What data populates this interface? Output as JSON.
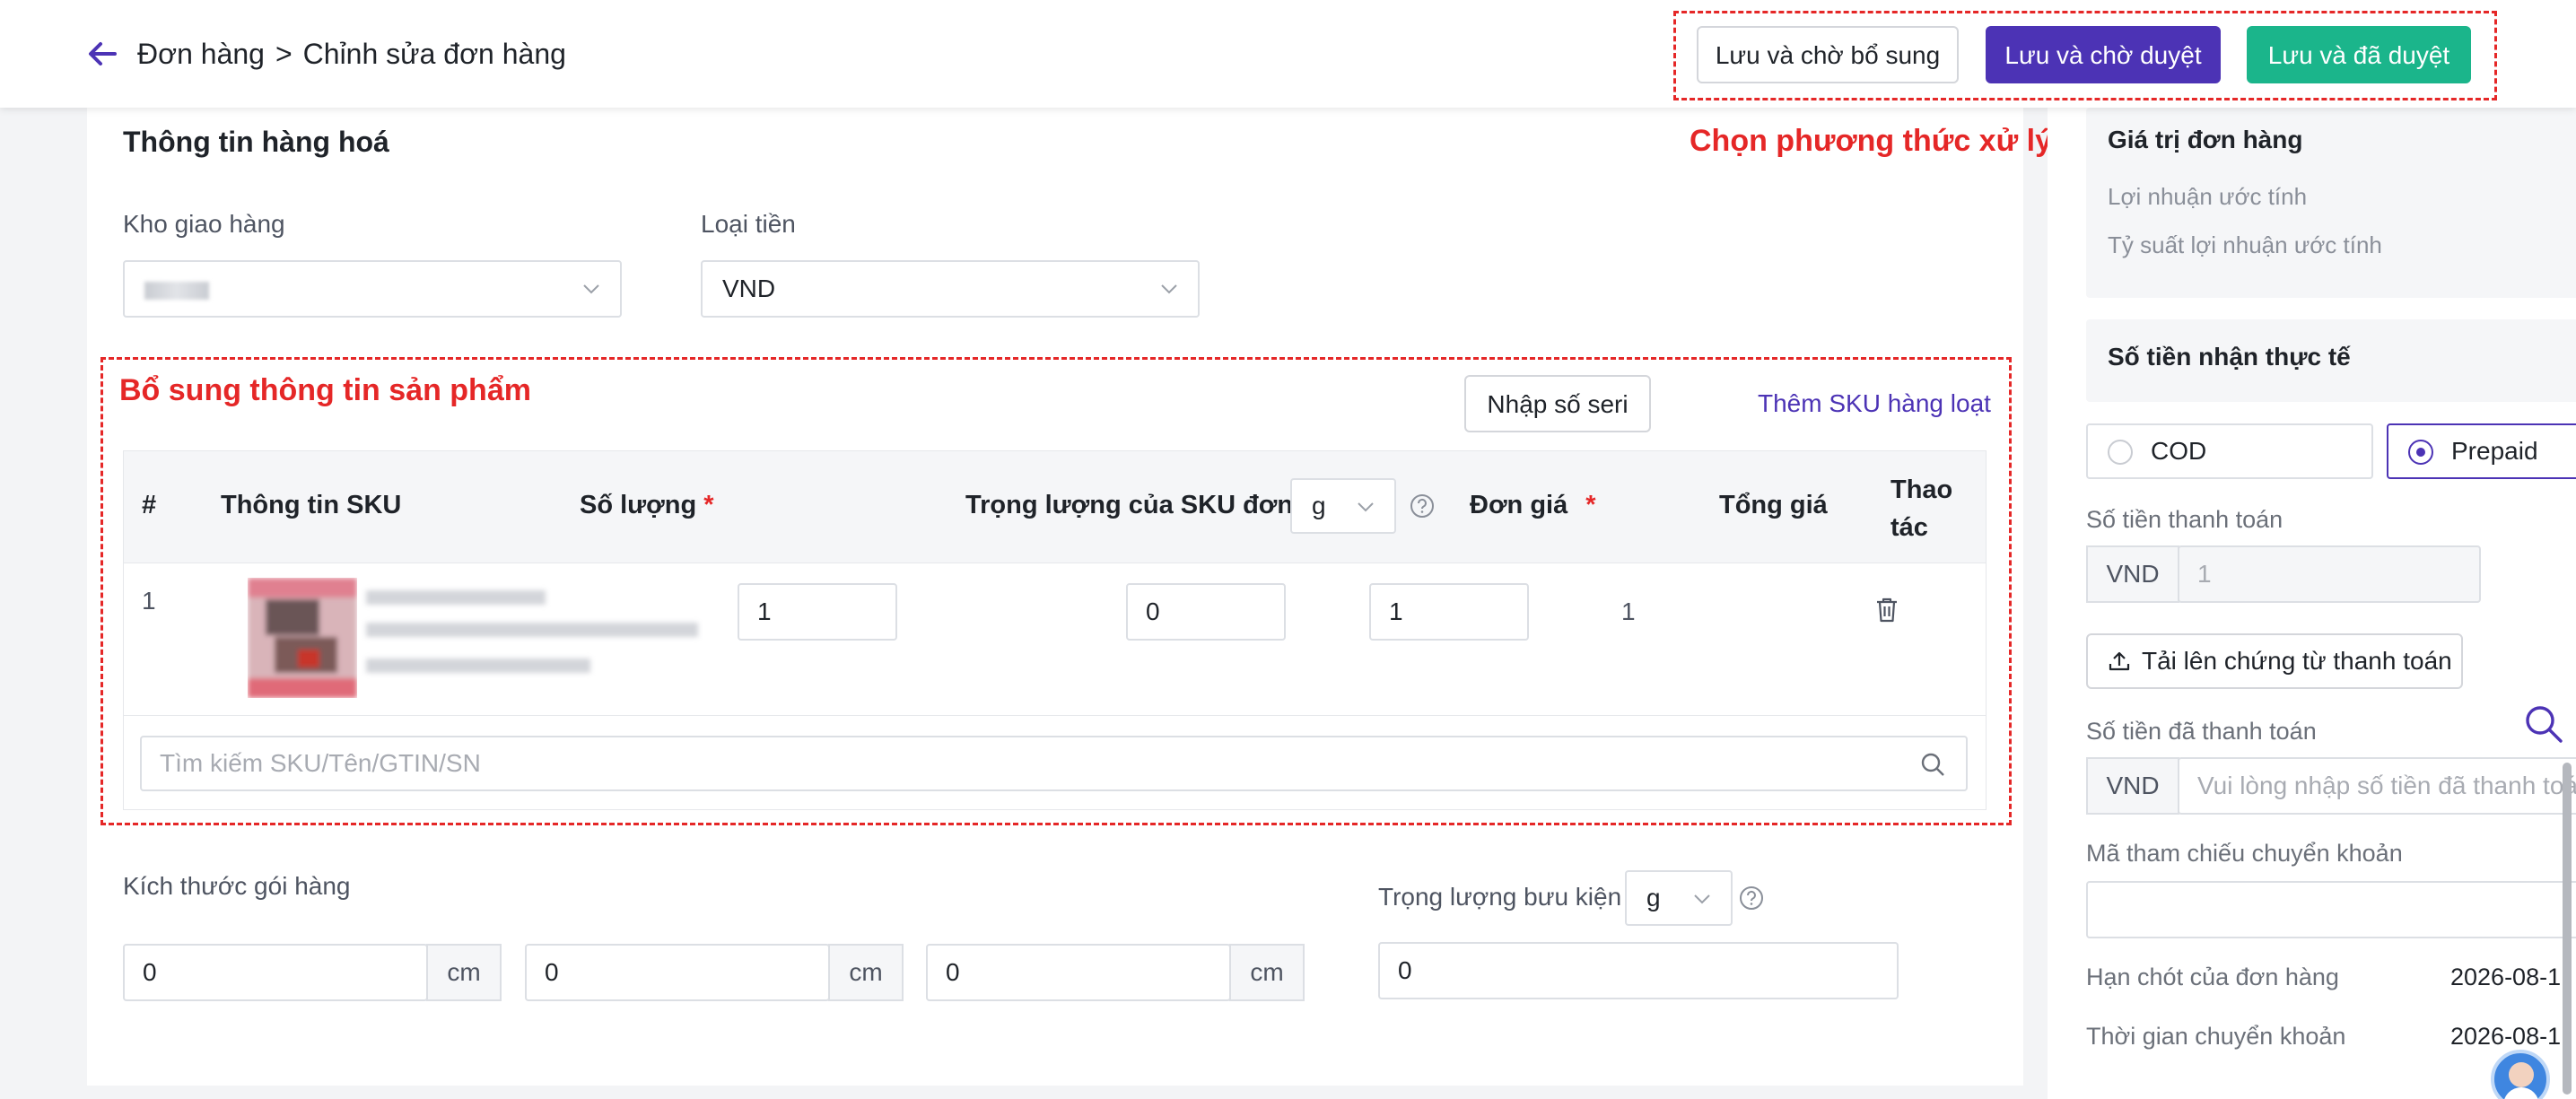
{
  "header": {
    "breadcrumb_parent": "Đơn hàng",
    "breadcrumb_separator": ">",
    "breadcrumb_current": "Chỉnh sửa đơn hàng",
    "btn_save_wait_supplement": "Lưu và chờ bổ sung",
    "btn_save_wait_approve": "Lưu và chờ duyệt",
    "btn_save_approved": "Lưu và đã duyệt",
    "annotation_process": "Chọn phương thức xử lý"
  },
  "goods": {
    "title": "Thông tin hàng hoá",
    "warehouse_label": "Kho giao hàng",
    "currency_label": "Loại tiền",
    "currency_value": "VND",
    "annotation_product": "Bổ sung thông tin sản phẩm",
    "btn_serial": "Nhập số seri",
    "btn_bulk_sku": "Thêm SKU hàng loạt",
    "table": {
      "headers": {
        "index": "#",
        "sku_info": "Thông tin SKU",
        "quantity": "Số lượng",
        "weight": "Trọng lượng của SKU đơn lẻ",
        "weight_unit": "g",
        "unit_price": "Đơn giá",
        "total": "Tổng giá",
        "action": "Thao tác"
      },
      "required_mark": "*",
      "rows": [
        {
          "index": "1",
          "quantity": "1",
          "weight": "0",
          "unit_price": "1",
          "total": "1"
        }
      ]
    },
    "search_placeholder": "Tìm kiếm SKU/Tên/GTIN/SN"
  },
  "package": {
    "size_label": "Kích thước gói hàng",
    "length": "0",
    "width": "0",
    "height": "0",
    "unit": "cm",
    "weight_label": "Trọng lượng bưu kiện",
    "weight_unit": "g",
    "weight_value": "0"
  },
  "side": {
    "order_value_title": "Giá trị đơn hàng",
    "est_profit": "Lợi nhuận ước tính",
    "est_margin": "Tỷ suất lợi nhuận ước tính",
    "actual_received_title": "Số tiền nhận thực tế",
    "cod_label": "COD",
    "prepaid_label": "Prepaid",
    "payment_amount_label": "Số tiền thanh toán",
    "currency": "VND",
    "payment_amount_value": "1",
    "upload_button": "Tải lên chứng từ thanh toán",
    "paid_amount_label": "Số tiền đã thanh toán",
    "paid_amount_placeholder": "Vui lòng nhập số tiền đã thanh toán",
    "transfer_ref_label": "Mã tham chiếu chuyển khoản",
    "deadline_label": "Hạn chót của đơn hàng",
    "deadline_value": "2026-08-1",
    "transfer_time_label": "Thời gian chuyển khoản",
    "transfer_time_value": "2026-08-1"
  },
  "colors": {
    "primary": "#4c33b5",
    "success": "#1bb58b",
    "annotation": "#e52727"
  }
}
